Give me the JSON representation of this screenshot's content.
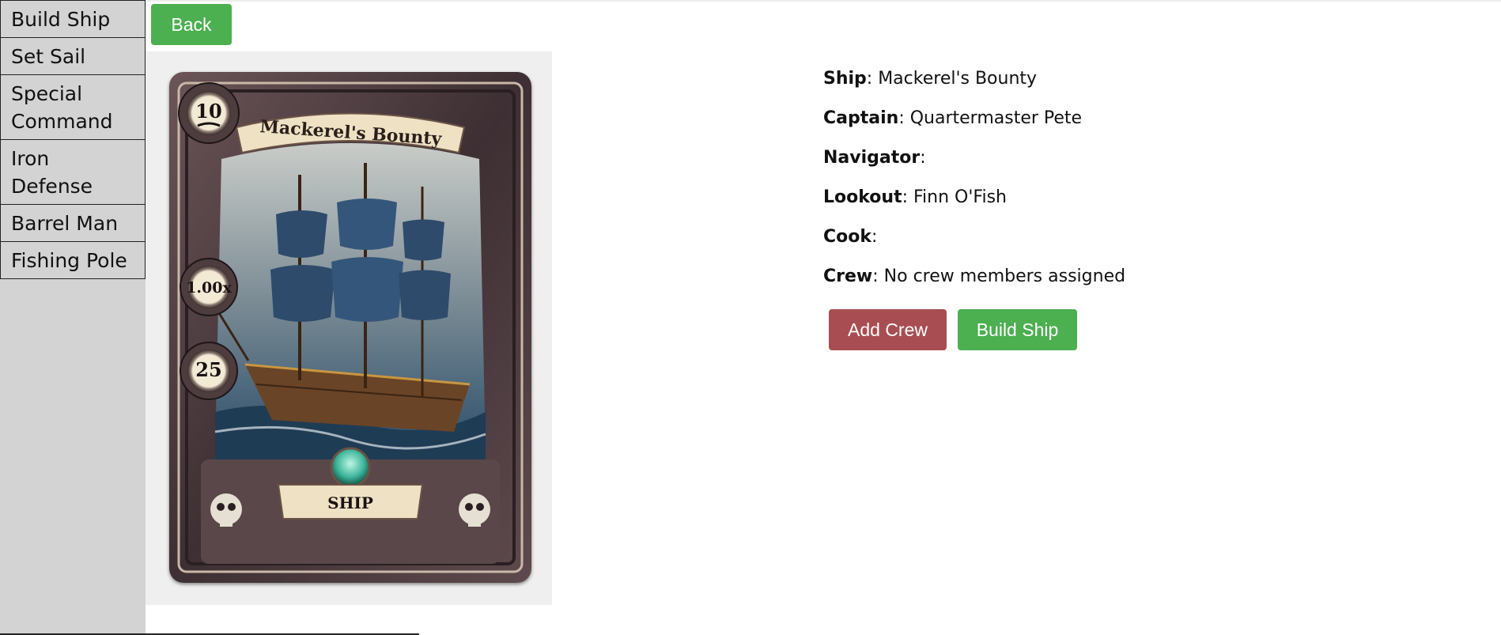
{
  "sidebar": {
    "items": [
      {
        "label": "Build Ship"
      },
      {
        "label": "Set Sail"
      },
      {
        "label": "Special Command"
      },
      {
        "label": "Iron Defense"
      },
      {
        "label": "Barrel Man"
      },
      {
        "label": "Fishing Pole"
      }
    ]
  },
  "toolbar": {
    "back_label": "Back"
  },
  "card": {
    "title": "Mackerel's Bounty",
    "type_label": "SHIP",
    "stat_top": "10",
    "stat_middle": "1.00x",
    "stat_bottom": "25",
    "colors": {
      "frame": "#4a3a3e",
      "scroll": "#efe2c4",
      "sea": "#2d4f6b",
      "gem": "#3fb59a"
    }
  },
  "details": {
    "ship_label": "Ship",
    "ship_value": ": Mackerel's Bounty",
    "captain_label": "Captain",
    "captain_value": ": Quartermaster Pete",
    "navigator_label": "Navigator",
    "navigator_value": ":",
    "lookout_label": "Lookout",
    "lookout_value": ": Finn O'Fish",
    "cook_label": "Cook",
    "cook_value": ":",
    "crew_label": "Crew",
    "crew_value": ": No crew members assigned"
  },
  "actions": {
    "add_crew_label": "Add Crew",
    "build_ship_label": "Build Ship"
  },
  "theme": {
    "green": "#4caf50",
    "red": "#a84e52",
    "sidebar_bg": "#d3d3d3",
    "panel_bg": "#efefef"
  }
}
